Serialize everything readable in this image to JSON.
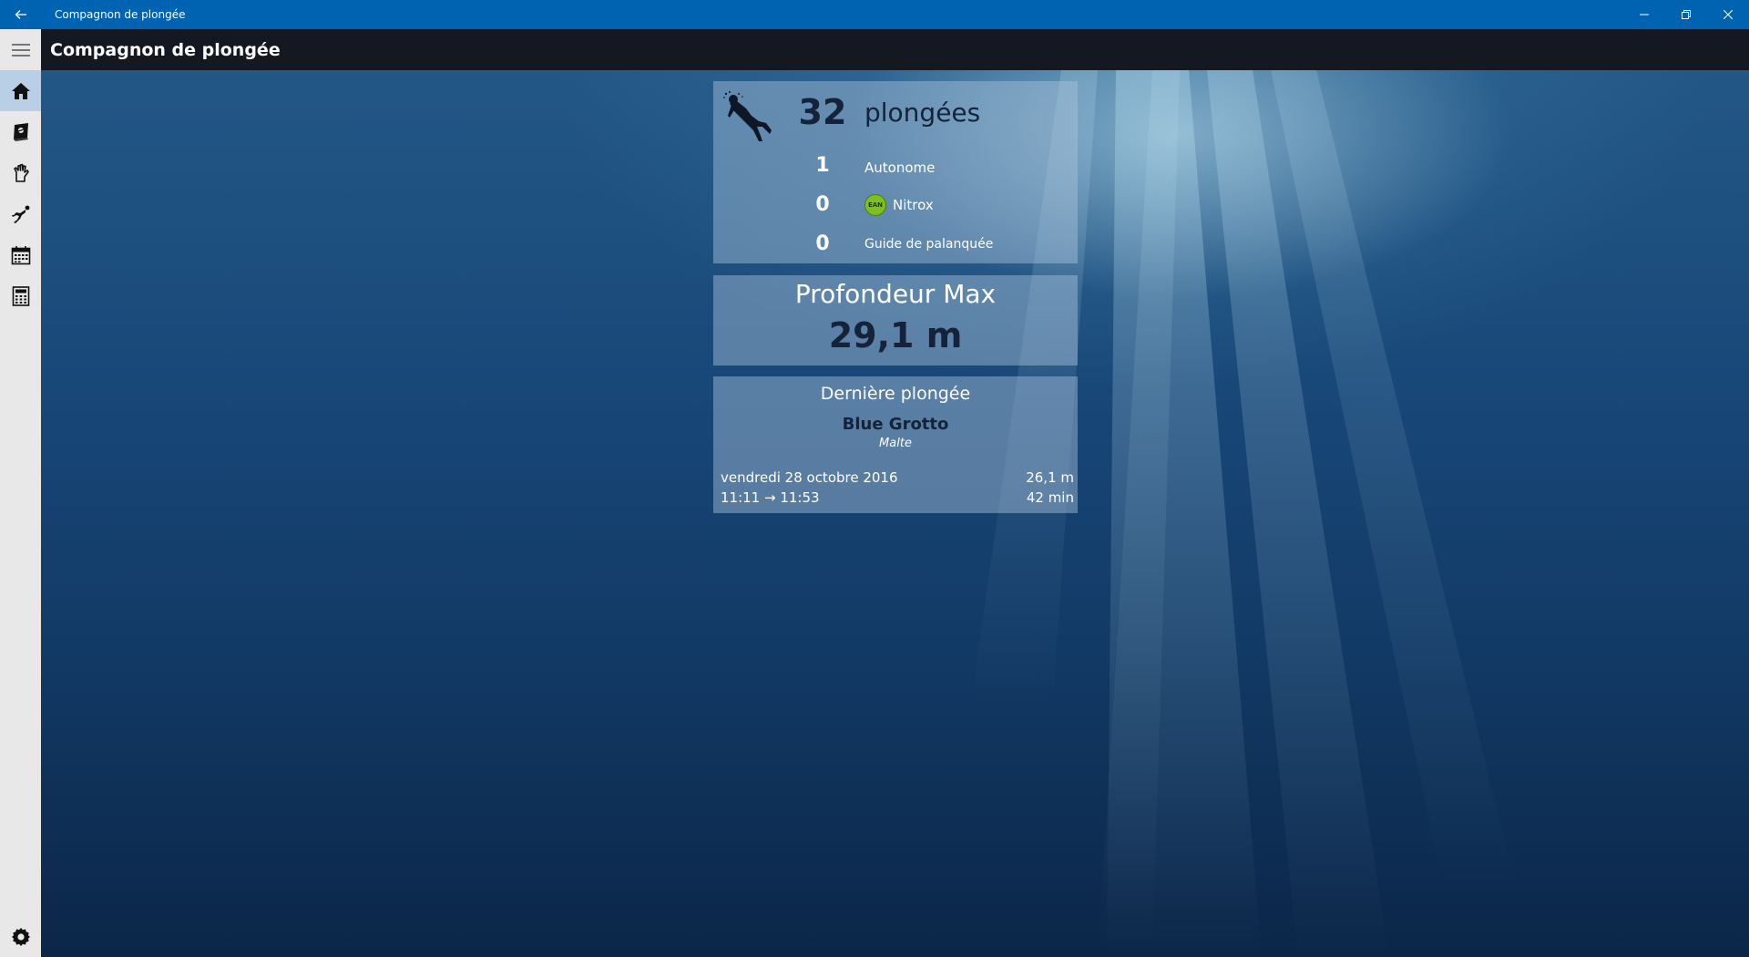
{
  "window": {
    "title": "Compagnon de plongée"
  },
  "header": {
    "app_title": "Compagnon de plongée"
  },
  "sidebar": {
    "items": [
      {
        "icon": "home-icon",
        "active": true
      },
      {
        "icon": "logbook-icon",
        "active": false
      },
      {
        "icon": "hand-icon",
        "active": false
      },
      {
        "icon": "diver-icon",
        "active": false
      },
      {
        "icon": "calendar-icon",
        "active": false
      },
      {
        "icon": "calculator-icon",
        "active": false
      }
    ],
    "settings_icon": "gear-icon"
  },
  "stats": {
    "total_count": "32",
    "total_label": "plongées",
    "rows": [
      {
        "count": "1",
        "label": "Autonome"
      },
      {
        "count": "0",
        "label": "Nitrox",
        "badge": "EAN"
      },
      {
        "count": "0",
        "label": "Guide de palanquée"
      }
    ]
  },
  "max_depth": {
    "title": "Profondeur Max",
    "value": "29,1 m"
  },
  "last_dive": {
    "title": "Dernière plongée",
    "site": "Blue Grotto",
    "country": "Malte",
    "date": "vendredi 28 octobre 2016",
    "time_range": "11:11 → 11:53",
    "depth": "26,1 m",
    "duration": "42 min"
  },
  "colors": {
    "titlebar": "#0063b1",
    "accent_text": "#14233a",
    "nav_active": "#b9cfe6",
    "ean_badge": "#7ec01f"
  }
}
